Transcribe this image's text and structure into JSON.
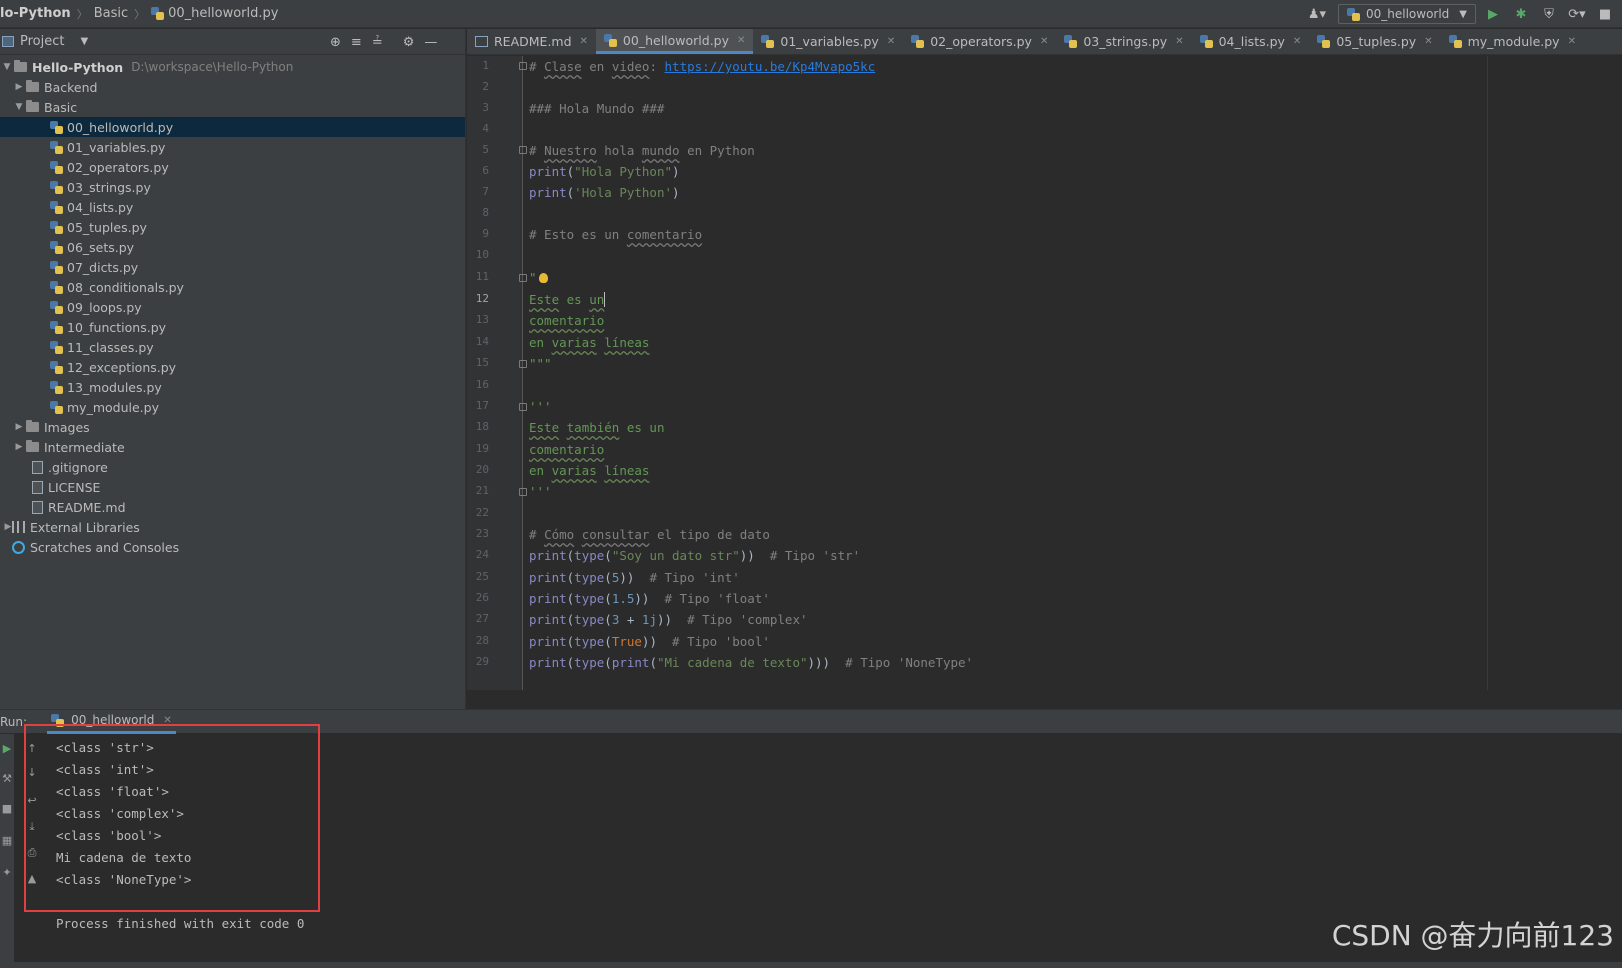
{
  "navbar": {
    "crumbs": [
      "lo-Python",
      "Basic",
      "00_helloworld.py"
    ],
    "run_config": "00_helloworld"
  },
  "project": {
    "title": "Project",
    "root_name": "Hello-Python",
    "root_path": "D:\\workspace\\Hello-Python",
    "folders_top": [
      "Backend",
      "Basic"
    ],
    "basic_files": [
      "00_helloworld.py",
      "01_variables.py",
      "02_operators.py",
      "03_strings.py",
      "04_lists.py",
      "05_tuples.py",
      "06_sets.py",
      "07_dicts.py",
      "08_conditionals.py",
      "09_loops.py",
      "10_functions.py",
      "11_classes.py",
      "12_exceptions.py",
      "13_modules.py",
      "my_module.py"
    ],
    "folders_bottom": [
      "Images",
      "Intermediate"
    ],
    "root_files": [
      ".gitignore",
      "LICENSE",
      "README.md"
    ],
    "external_libraries": "External Libraries",
    "scratches": "Scratches and Consoles"
  },
  "tabs": [
    "README.md",
    "00_helloworld.py",
    "01_variables.py",
    "02_operators.py",
    "03_strings.py",
    "04_lists.py",
    "05_tuples.py",
    "my_module.py"
  ],
  "editor": {
    "lines": {
      "l1_a": "# ",
      "l1_b": "Clase",
      "l1_c": " en ",
      "l1_d": "video",
      "l1_e": ": ",
      "l1_url": "https://youtu.be/Kp4Mvapo5kc",
      "l3": "### Hola Mundo ###",
      "l5_a": "# ",
      "l5_b": "Nuestro",
      "l5_c": " hola ",
      "l5_d": "mundo",
      "l5_e": " en Python",
      "l6_fn": "print",
      "l6_str": "\"Hola Python\"",
      "l7_fn": "print",
      "l7_str": "'Hola Python'",
      "l9_a": "# Esto es un ",
      "l9_b": "comentario",
      "l11": "\"",
      "l12_a": "Este",
      "l12_b": " es ",
      "l12_c": "un",
      "l13": "comentario",
      "l14_a": "en ",
      "l14_b": "varias",
      "l14_c": " ",
      "l14_d": "líneas",
      "l15": "\"\"\"",
      "l17": "'''",
      "l18_a": "Este",
      "l18_b": " ",
      "l18_c": "también",
      "l18_d": " es un",
      "l19": "comentario",
      "l20_a": "en ",
      "l20_b": "varias",
      "l20_c": " ",
      "l20_d": "líneas",
      "l21": "'''",
      "l23_a": "# ",
      "l23_b": "Cómo",
      "l23_c": " ",
      "l23_d": "consultar",
      "l23_e": " el tipo de dato",
      "l24_str": "\"Soy un dato str\"",
      "l24_com": "# Tipo 'str'",
      "l25_num": "5",
      "l25_com": "# Tipo 'int'",
      "l26_num": "1.5",
      "l26_com": "# Tipo 'float'",
      "l27_num": "3",
      "l27_op": " + ",
      "l27_num2": "1j",
      "l27_com": "# Tipo 'complex'",
      "l28_kw": "True",
      "l28_com": "# Tipo 'bool'",
      "l29_str": "\"Mi cadena de texto\"",
      "l29_com": "# Tipo 'NoneType'",
      "fn_print": "print",
      "fn_type": "type"
    }
  },
  "run": {
    "label": "Run:",
    "tab": "00_helloworld",
    "output": [
      "<class 'str'>",
      "<class 'int'>",
      "<class 'float'>",
      "<class 'complex'>",
      "<class 'bool'>",
      "Mi cadena de texto",
      "<class 'NoneType'>",
      "",
      "Process finished with exit code 0"
    ]
  },
  "watermark": "CSDN @奋力向前123"
}
